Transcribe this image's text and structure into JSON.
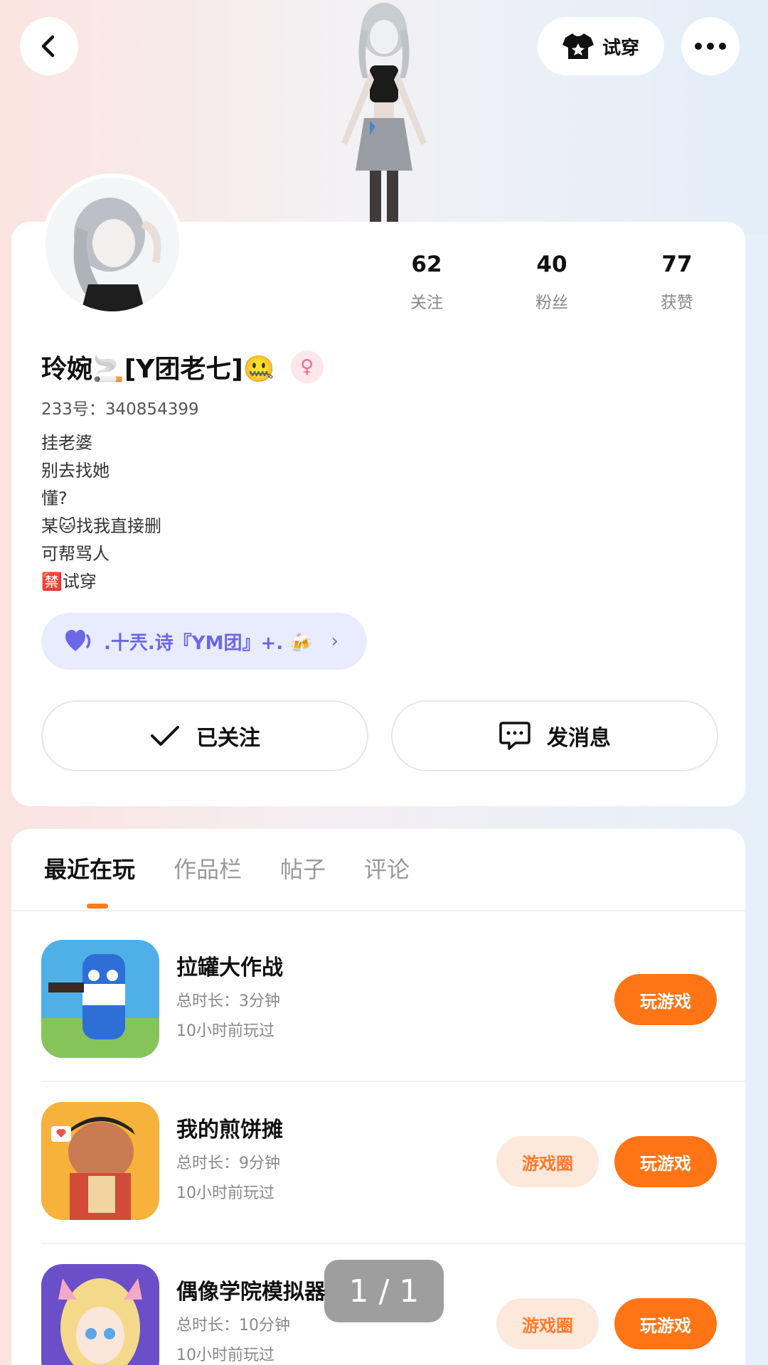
{
  "header": {
    "tryon_label": "试穿"
  },
  "profile": {
    "stats": [
      {
        "num": "62",
        "label": "关注"
      },
      {
        "num": "40",
        "label": "粉丝"
      },
      {
        "num": "77",
        "label": "获赞"
      }
    ],
    "name": "玲婉🚬[Y团老七]🤐",
    "uid": "233号：340854399",
    "bio": [
      "挂老婆",
      "别去找她",
      "懂?",
      "某🐱找我直接删",
      "可帮骂人",
      "🈲试穿"
    ],
    "group_chip": ".十兲.诗『YM团』+. 🍻",
    "follow_label": "已关注",
    "message_label": "发消息"
  },
  "tabs": [
    "最近在玩",
    "作品栏",
    "帖子",
    "评论"
  ],
  "games": [
    {
      "title": "拉罐大作战",
      "duration": "总时长：3分钟",
      "last": "10小时前玩过",
      "has_circle": false,
      "play_label": "玩游戏"
    },
    {
      "title": "我的煎饼摊",
      "duration": "总时长：9分钟",
      "last": "10小时前玩过",
      "has_circle": true,
      "circle_label": "游戏圈",
      "play_label": "玩游戏"
    },
    {
      "title": "偶像学院模拟器",
      "duration": "总时长：10分钟",
      "last": "10小时前玩过",
      "has_circle": true,
      "circle_label": "游戏圈",
      "play_label": "玩游戏"
    }
  ],
  "pager": "1 / 1",
  "colors": {
    "accent": "#ff7414",
    "chip_bg": "#e9ebff",
    "chip_text": "#6b68e8"
  }
}
